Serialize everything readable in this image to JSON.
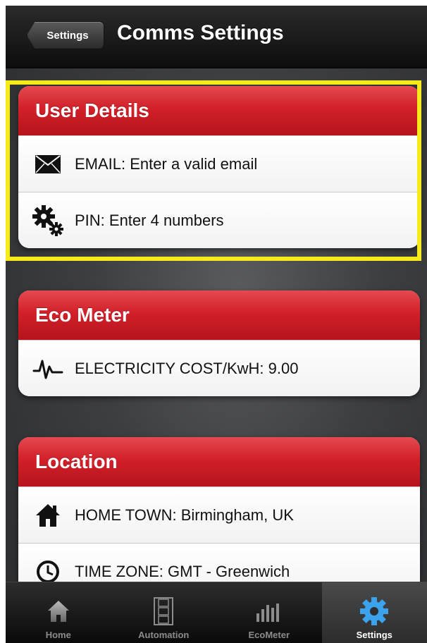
{
  "navbar": {
    "back_label": "Settings",
    "title": "Comms Settings"
  },
  "user_details": {
    "header": "User Details",
    "email_label": "EMAIL: Enter a valid email",
    "pin_label": "PIN: Enter 4 numbers"
  },
  "eco_meter": {
    "header": "Eco Meter",
    "cost_label": "ELECTRICITY COST/KwH: 9.00"
  },
  "location": {
    "header": "Location",
    "home_town_label": "HOME TOWN: Birmingham, UK",
    "time_zone_label": "TIME ZONE: GMT - Greenwich"
  },
  "tabs": [
    {
      "label": "Home",
      "icon": "home-icon"
    },
    {
      "label": "Automation",
      "icon": "film-icon"
    },
    {
      "label": "EcoMeter",
      "icon": "bar-chart-icon"
    },
    {
      "label": "Settings",
      "icon": "gear-icon"
    }
  ],
  "colors": {
    "header_red": "#d2202a",
    "highlight": "#f7ea1a",
    "active_tab_icon": "#3ba3ee"
  }
}
